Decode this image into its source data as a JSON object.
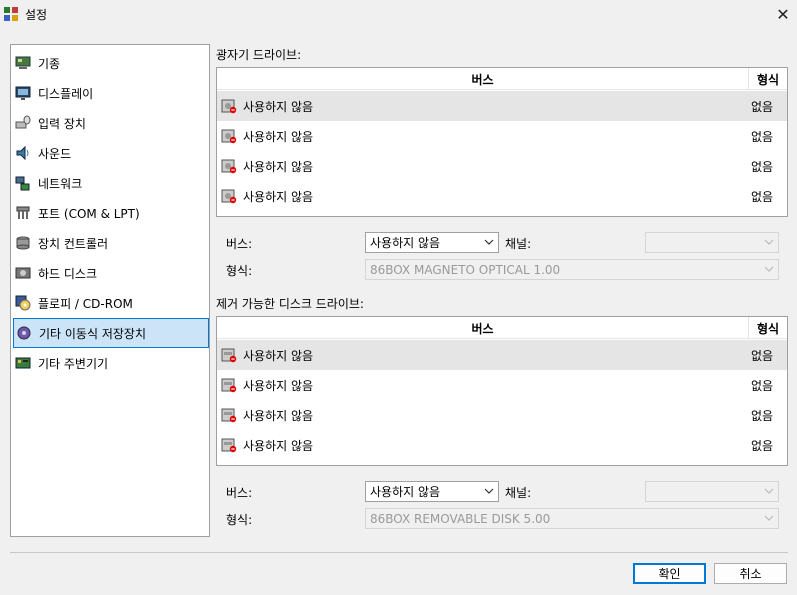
{
  "window": {
    "title": "설정",
    "close_glyph": "✕"
  },
  "sidebar": {
    "items": [
      {
        "label": "기종",
        "icon": "machine-icon"
      },
      {
        "label": "디스플레이",
        "icon": "display-icon"
      },
      {
        "label": "입력 장치",
        "icon": "input-devices-icon"
      },
      {
        "label": "사운드",
        "icon": "sound-icon"
      },
      {
        "label": "네트워크",
        "icon": "network-icon"
      },
      {
        "label": "포트 (COM & LPT)",
        "icon": "ports-icon"
      },
      {
        "label": "장치 컨트롤러",
        "icon": "storage-controllers-icon"
      },
      {
        "label": "하드 디스크",
        "icon": "hard-disk-icon"
      },
      {
        "label": "플로피 / CD-ROM",
        "icon": "floppy-cdrom-icon"
      },
      {
        "label": "기타 이동식 저장장치",
        "icon": "removable-storage-icon"
      },
      {
        "label": "기타 주변기기",
        "icon": "peripherals-icon"
      }
    ],
    "selected_index": 9
  },
  "optical": {
    "group_title": "광자기 드라이브:",
    "col_bus": "버스",
    "col_type": "형식",
    "rows": [
      {
        "bus": "사용하지 않음",
        "type": "없음"
      },
      {
        "bus": "사용하지 않음",
        "type": "없음"
      },
      {
        "bus": "사용하지 않음",
        "type": "없음"
      },
      {
        "bus": "사용하지 않음",
        "type": "없음"
      }
    ],
    "bus_label": "버스:",
    "bus_value": "사용하지 않음",
    "channel_label": "채널:",
    "channel_value": "",
    "type_label": "형식:",
    "type_value": "86BOX MAGNETO OPTICAL 1.00"
  },
  "removable": {
    "group_title": "제거 가능한 디스크 드라이브:",
    "col_bus": "버스",
    "col_type": "형식",
    "rows": [
      {
        "bus": "사용하지 않음",
        "type": "없음"
      },
      {
        "bus": "사용하지 않음",
        "type": "없음"
      },
      {
        "bus": "사용하지 않음",
        "type": "없음"
      },
      {
        "bus": "사용하지 않음",
        "type": "없음"
      }
    ],
    "bus_label": "버스:",
    "bus_value": "사용하지 않음",
    "channel_label": "채널:",
    "channel_value": "",
    "type_label": "형식:",
    "type_value": "86BOX REMOVABLE DISK 5.00"
  },
  "buttons": {
    "ok": "확인",
    "cancel": "취소"
  },
  "colors": {
    "accent": "#0078d7",
    "selection": "#cce4f7",
    "row_highlight": "#e5e5e5",
    "window_bg": "#f0f0f0"
  }
}
